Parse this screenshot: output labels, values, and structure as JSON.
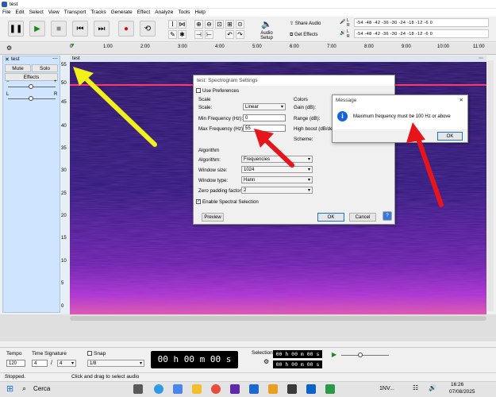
{
  "window": {
    "title": "test"
  },
  "menu": [
    "File",
    "Edit",
    "Select",
    "View",
    "Transport",
    "Tracks",
    "Generate",
    "Effect",
    "Analyze",
    "Tools",
    "Help"
  ],
  "toolbar": {
    "share_label": "Share Audio",
    "effects_label": "Get Effects",
    "audio_setup_label": "Audio Setup",
    "meter_scale": "-54 -48 -42 -36 -30 -24 -18 -12 -6 0",
    "meter_r": "R",
    "meter_l": "L"
  },
  "ruler": {
    "ticks": [
      "0",
      "1:00",
      "2:00",
      "3:00",
      "4:00",
      "5:00",
      "6:00",
      "7:00",
      "8:00",
      "9:00",
      "10:00",
      "11:00"
    ]
  },
  "track": {
    "name": "test",
    "mute": "Mute",
    "solo": "Solo",
    "effects": "Effects",
    "pan_l": "L",
    "pan_r": "R",
    "yaxis": [
      "55",
      "50",
      "45",
      "40",
      "35",
      "30",
      "25",
      "20",
      "15",
      "10",
      "5",
      "0"
    ]
  },
  "spec_dialog": {
    "title": "test: Spectrogram Settings",
    "use_prefs": "Use Preferences",
    "scale_group": "Scale",
    "scale_label": "Scale:",
    "scale_value": "Linear",
    "minf_label": "Min Frequency (Hz):",
    "minf_value": "0",
    "maxf_label": "Max Frequency (Hz):",
    "maxf_value": "55",
    "colors_group": "Colors",
    "gain_label": "Gain (dB):",
    "range_label": "Range (dB):",
    "boost_label": "High boost (dB/dec):",
    "scheme_label": "Scheme:",
    "algo_group": "Algorithm",
    "algo_label": "Algorithm:",
    "algo_value": "Frequencies",
    "wsize_label": "Window size:",
    "wsize_value": "1024",
    "wtype_label": "Window type:",
    "wtype_value": "Hann",
    "zpad_label": "Zero padding factor:",
    "zpad_value": "2",
    "spectral_sel": "Enable Spectral Selection",
    "preview": "Preview",
    "ok": "OK",
    "cancel": "Cancel",
    "help": "?"
  },
  "message": {
    "title": "Message",
    "text": "Maximum frequency must be 100 Hz or above",
    "ok": "OK",
    "close": "✕"
  },
  "bottom": {
    "tempo_label": "Tempo",
    "tempo_value": "120",
    "sig_label": "Time Signature",
    "sig_num": "4",
    "sig_den": "4",
    "snap_label": "Snap",
    "snap_value": "1/8",
    "time_display": "00 h 00 m 00 s",
    "selection_label": "Selection",
    "sel_start": "00 h 00 m 00 s",
    "sel_end": "00 h 00 m 00 s"
  },
  "status": {
    "left": "Stopped.",
    "right": "Click and drag to select audio"
  },
  "taskbar": {
    "search": "Cerca",
    "lang": "1NV...",
    "time": "16:26",
    "date": "07/08/2025"
  },
  "colors": {
    "arrow_red": "#e8141c",
    "arrow_yellow": "#f2f21a",
    "info_blue": "#1565d8"
  }
}
